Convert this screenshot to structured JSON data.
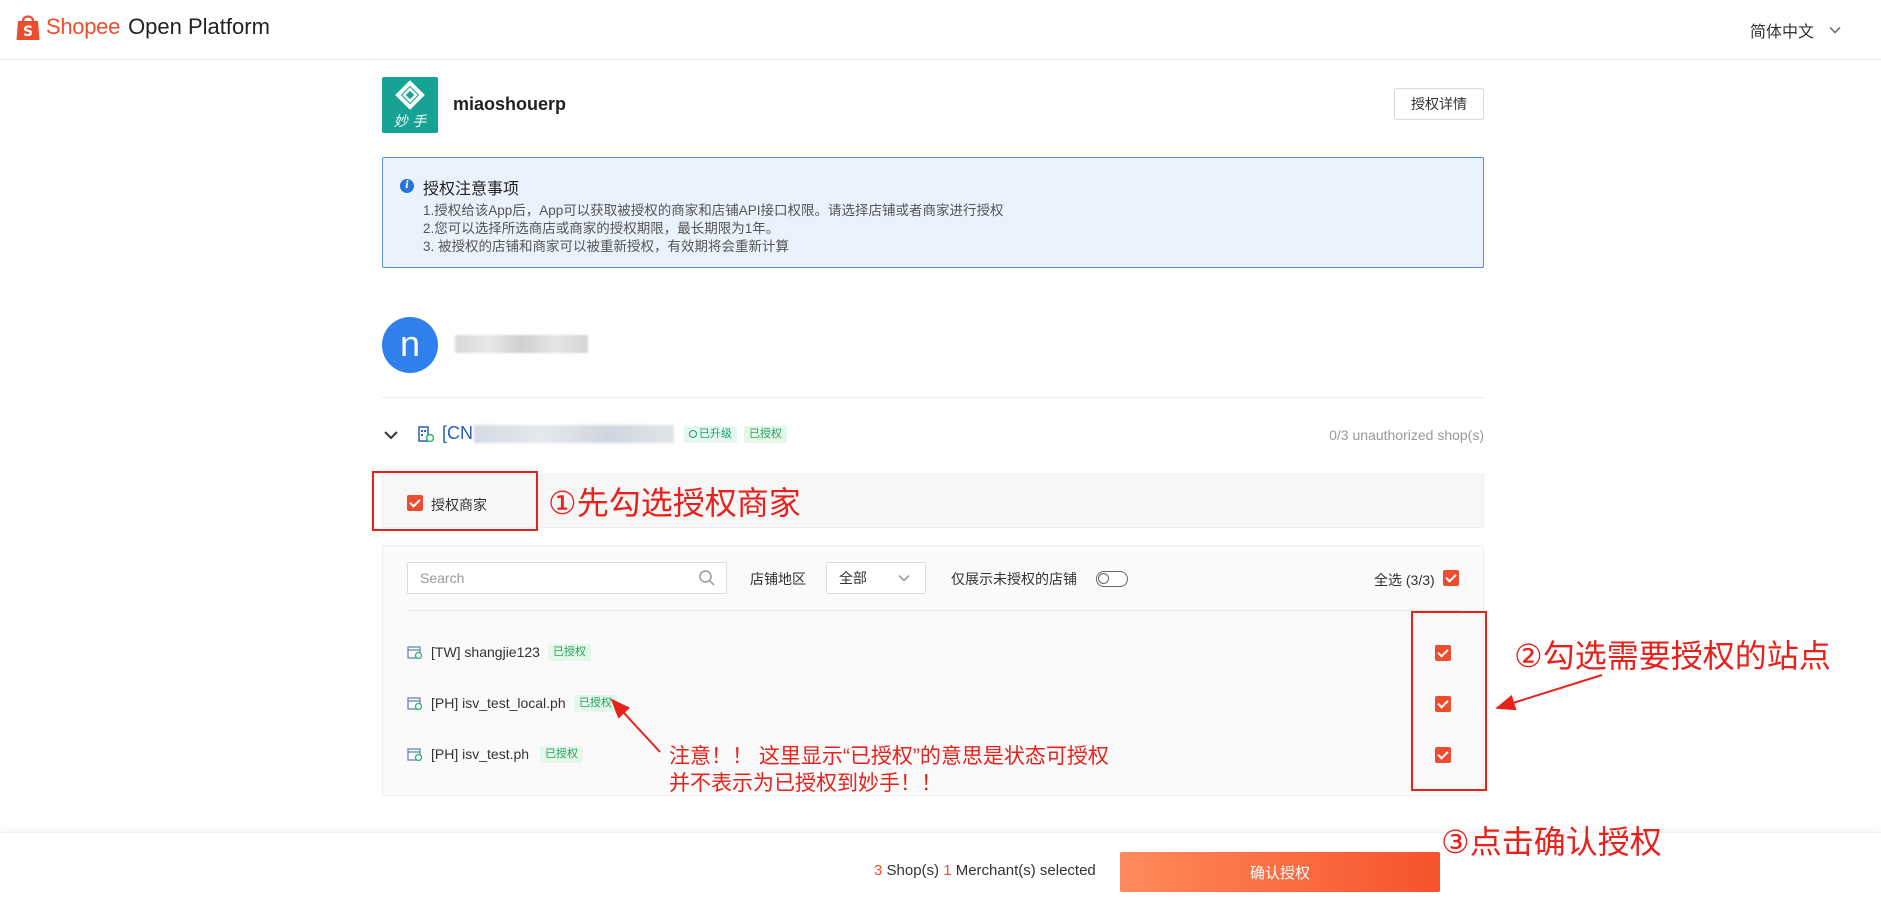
{
  "header": {
    "brand": "Shopee",
    "product": "Open Platform",
    "language": "简体中文"
  },
  "app": {
    "logo_text": "妙 手",
    "name": "miaoshouerp",
    "detail_button": "授权详情"
  },
  "notice": {
    "title": "授权注意事项",
    "lines": [
      "1.授权给该App后，App可以获取被授权的商家和店铺API接口权限。请选择店铺或者商家进行授权",
      "2.您可以选择所选商店或商家的授权期限，最长期限为1年。",
      "3. 被授权的店铺和商家可以被重新授权，有效期将会重新计算"
    ]
  },
  "user": {
    "avatar_letter": "n"
  },
  "merchant": {
    "name_prefix": "[CN",
    "upgraded_tag": "已升级",
    "authorized_tag": "已授权",
    "unauthorized_count": "0/3 unauthorized shop(s)",
    "authorize_merchant_label": "授权商家"
  },
  "filters": {
    "search_placeholder": "Search",
    "region_label": "店铺地区",
    "region_value": "全部",
    "only_unauthorized_label": "仅展示未授权的店铺",
    "select_all_label": "全选 (3/3)"
  },
  "shops": [
    {
      "name": "[TW] shangjie123",
      "tag": "已授权"
    },
    {
      "name": "[PH] isv_test_local.ph",
      "tag": "已授权"
    },
    {
      "name": "[PH] isv_test.ph",
      "tag": "已授权"
    }
  ],
  "annotations": {
    "step1": "①先勾选授权商家",
    "step2": "②勾选需要授权的站点",
    "step3": "③点击确认授权",
    "note_line1": "注意！！ 这里显示“已授权”的意思是状态可授权",
    "note_line2": "并不表示为已授权到妙手！！"
  },
  "footer": {
    "shop_count": "3",
    "shop_text": " Shop(s) ",
    "merchant_count": "1",
    "merchant_text": " Merchant(s) selected",
    "confirm_button": "确认授权"
  },
  "colors": {
    "brand": "#ee4d2d",
    "annotation": "#e8211a",
    "notice_bg": "#eaf2fd",
    "app_logo": "#17a394"
  }
}
